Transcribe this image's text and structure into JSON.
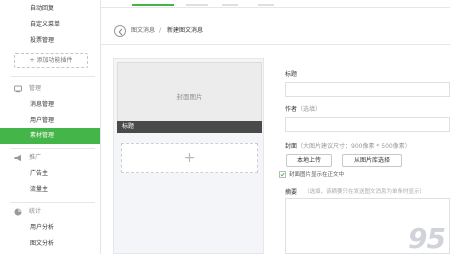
{
  "sidebar": {
    "menu_items": [
      {
        "label": "自动回复"
      },
      {
        "label": "自定义菜单"
      },
      {
        "label": "投票管理"
      }
    ],
    "add_plugin_label": "+ 添加功能插件",
    "groups": [
      {
        "title": "管理",
        "icon": "management-icon",
        "items": [
          {
            "label": "消息管理"
          },
          {
            "label": "用户管理"
          },
          {
            "label": "素材管理",
            "active": true
          }
        ]
      },
      {
        "title": "推广",
        "icon": "megaphone-icon",
        "items": [
          {
            "label": "广告主"
          },
          {
            "label": "流量主"
          }
        ]
      },
      {
        "title": "统计",
        "icon": "chart-icon",
        "items": [
          {
            "label": "用户分析"
          },
          {
            "label": "图文分析"
          }
        ]
      }
    ]
  },
  "breadcrumb": {
    "parent": "图文消息",
    "separator": "/",
    "current": "新建图文消息"
  },
  "preview": {
    "cover_placeholder": "封面图片",
    "title_label": "标题",
    "add_icon": "+"
  },
  "form": {
    "title_label": "标题",
    "author_label": "作者",
    "author_hint": "（选填）",
    "cover_label": "封面",
    "cover_hint": "（大图片建议尺寸：900像素 * 500像素）",
    "upload_button": "本地上传",
    "library_button": "从图片库选择",
    "show_cover_label": "封面图片显示在正文中",
    "show_cover_checked": true,
    "summary_label": "摘要",
    "summary_hint": "（选填，该摘要只在发送图文消息为单条时显示）"
  },
  "watermark": "95",
  "colors": {
    "accent": "#44b549",
    "title_bar": "#4a4a4a",
    "cover_bg": "#ececec"
  }
}
